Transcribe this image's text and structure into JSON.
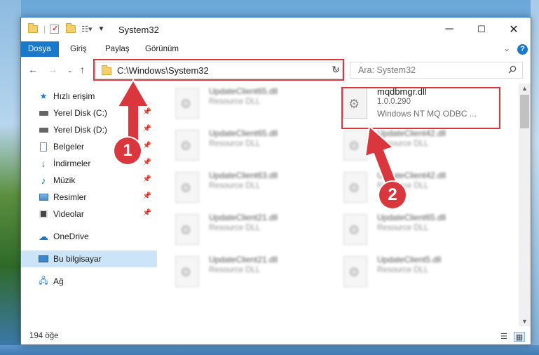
{
  "window": {
    "title": "System32",
    "minimize_glyph": "─",
    "maximize_glyph": "☐",
    "close_glyph": "✕"
  },
  "ribbon": {
    "tabs": [
      {
        "label": "Dosya",
        "active": true
      },
      {
        "label": "Giriş",
        "active": false
      },
      {
        "label": "Paylaş",
        "active": false
      },
      {
        "label": "Görünüm",
        "active": false
      }
    ],
    "help_glyph": "?"
  },
  "navigation": {
    "address": "C:\\Windows\\System32",
    "search_placeholder": "Ara: System32"
  },
  "sidebar": {
    "items": [
      {
        "label": "Hızlı erişim",
        "icon": "star-icon",
        "pinned": false
      },
      {
        "label": "Yerel Disk (C:)",
        "icon": "drive-icon",
        "pinned": true
      },
      {
        "label": "Yerel Disk (D:)",
        "icon": "drive-icon",
        "pinned": true
      },
      {
        "label": "Belgeler",
        "icon": "documents-icon",
        "pinned": true
      },
      {
        "label": "İndirmeler",
        "icon": "download-icon",
        "pinned": true
      },
      {
        "label": "Müzik",
        "icon": "music-icon",
        "pinned": true
      },
      {
        "label": "Resimler",
        "icon": "pictures-icon",
        "pinned": true
      },
      {
        "label": "Videolar",
        "icon": "videos-icon",
        "pinned": true
      },
      {
        "label": "OneDrive",
        "icon": "cloud-icon",
        "pinned": false
      },
      {
        "label": "Bu bilgisayar",
        "icon": "computer-icon",
        "pinned": false,
        "selected": true
      },
      {
        "label": "Ağ",
        "icon": "network-icon",
        "pinned": false
      }
    ]
  },
  "files": {
    "left_column": [
      {
        "name": "UpdateClient65.dll",
        "type": "Resource DLL"
      },
      {
        "name": "UpdateClient65.dll",
        "type": "Resource DLL"
      },
      {
        "name": "UpdateClient63.dll",
        "type": "Resource DLL"
      },
      {
        "name": "UpdateClient21.dll",
        "type": "Resource DLL"
      },
      {
        "name": "UpdateClient21.dll",
        "type": "Resource DLL"
      }
    ],
    "right_column": [
      {
        "name": "mqdbmgr.dll",
        "version": "1.0.0.290",
        "description": "Windows NT MQ ODBC ...",
        "highlighted": true
      },
      {
        "name": "UpdateClient42.dll",
        "type": "Resource DLL"
      },
      {
        "name": "UpdateClient42.dll",
        "type": "Resource DLL"
      },
      {
        "name": "UpdateClient65.dll",
        "type": "Resource DLL"
      },
      {
        "name": "UpdateClient5.dll",
        "type": "Resource DLL"
      }
    ]
  },
  "status": {
    "item_count": "194 öğe"
  },
  "annotations": {
    "badge1": "1",
    "badge2": "2",
    "highlight_color": "#d9363e"
  }
}
